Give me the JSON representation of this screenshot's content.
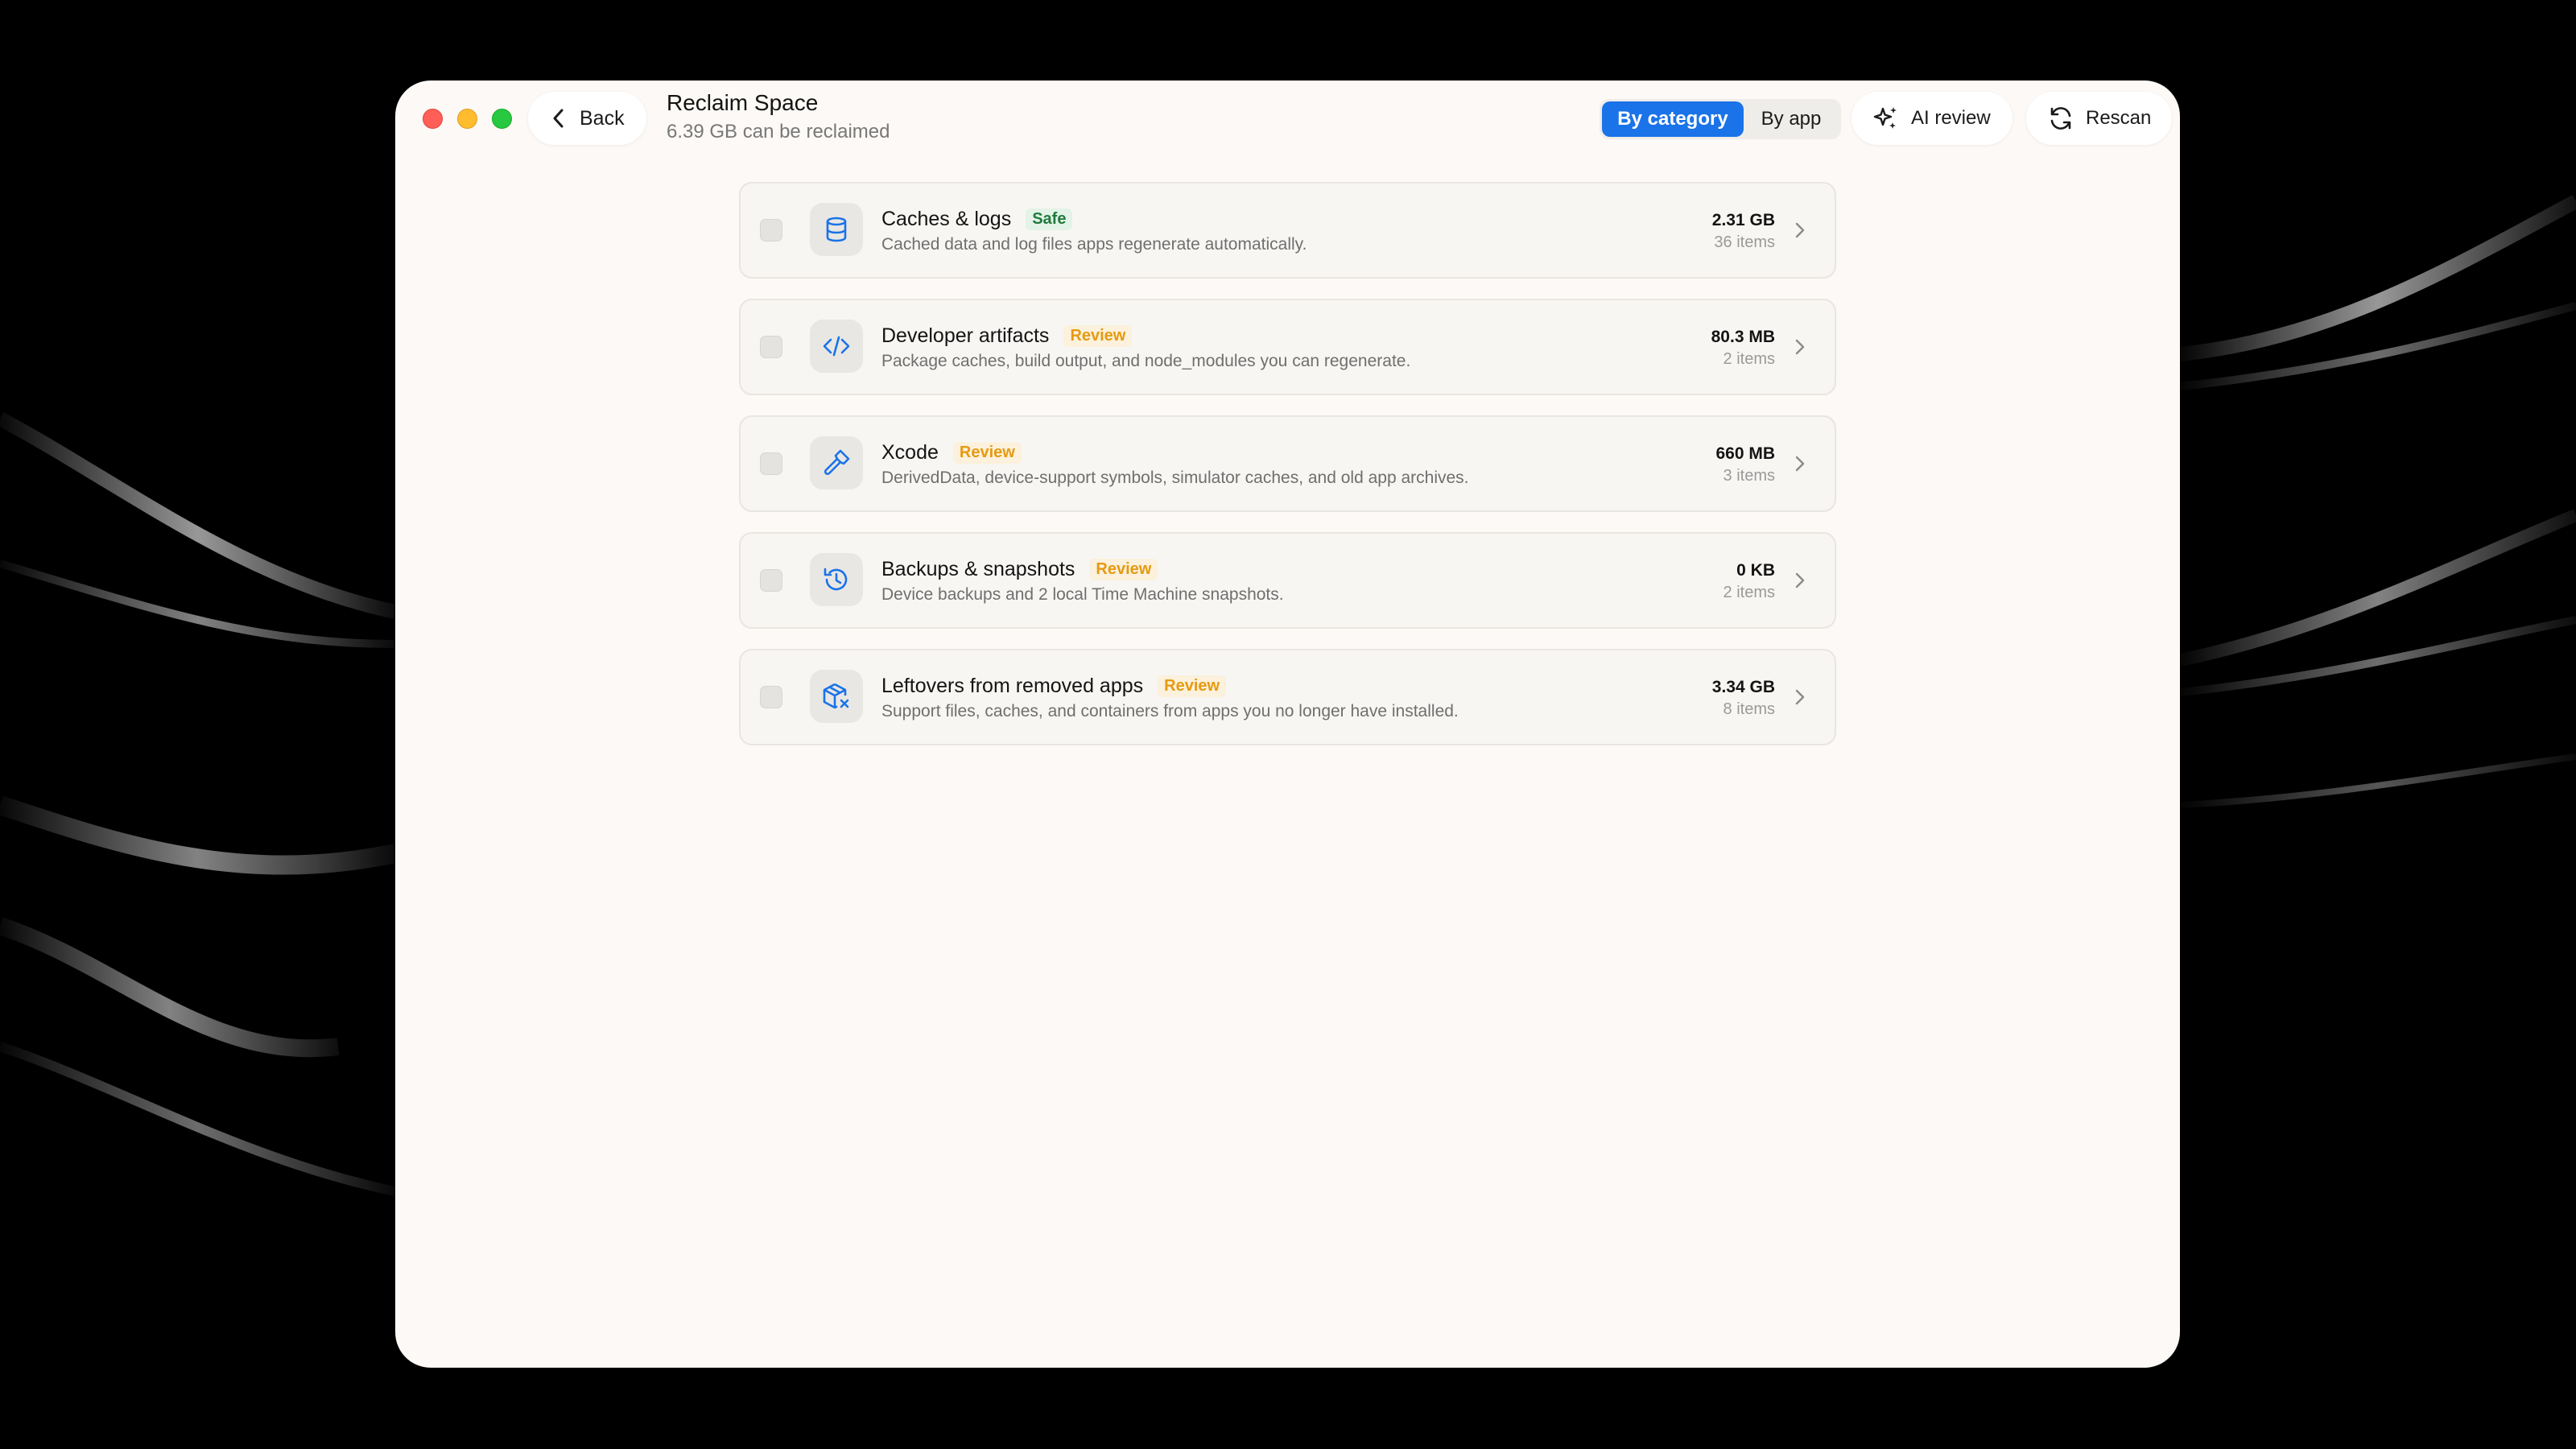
{
  "window": {
    "title": "Reclaim Space",
    "subtitle": "6.39 GB can be reclaimed",
    "back_label": "Back"
  },
  "toolbar": {
    "view_options": [
      "By category",
      "By app"
    ],
    "selected_view": "By category",
    "ai_review_label": "AI review",
    "rescan_label": "Rescan"
  },
  "colors": {
    "accent": "#1a73e8",
    "safe": "#1f7a3e",
    "review": "#e69a12"
  },
  "categories": [
    {
      "name": "Caches & logs",
      "badge": "Safe",
      "description": "Cached data and log files apps regenerate automatically.",
      "size": "2.31 GB",
      "count": "36 items",
      "icon": "database-icon"
    },
    {
      "name": "Developer artifacts",
      "badge": "Review",
      "description": "Package caches, build output, and node_modules you can regenerate.",
      "size": "80.3 MB",
      "count": "2 items",
      "icon": "code-icon"
    },
    {
      "name": "Xcode",
      "badge": "Review",
      "description": "DerivedData, device-support symbols, simulator caches, and old app archives.",
      "size": "660 MB",
      "count": "3 items",
      "icon": "hammer-icon"
    },
    {
      "name": "Backups & snapshots",
      "badge": "Review",
      "description": "Device backups and 2 local Time Machine snapshots.",
      "size": "0 KB",
      "count": "2 items",
      "icon": "history-icon"
    },
    {
      "name": "Leftovers from removed apps",
      "badge": "Review",
      "description": "Support files, caches, and containers from apps you no longer have installed.",
      "size": "3.34 GB",
      "count": "8 items",
      "icon": "package-x-icon"
    }
  ]
}
